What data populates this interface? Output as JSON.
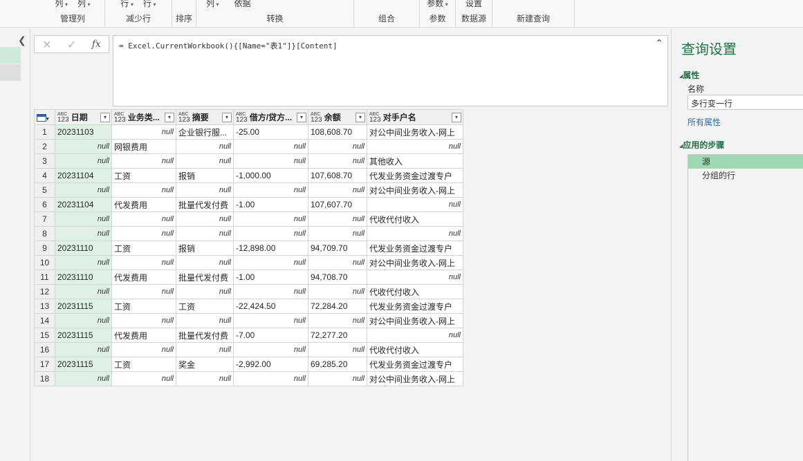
{
  "ribbon": {
    "groups": [
      {
        "label": "管理列",
        "items": [
          "列",
          "列"
        ]
      },
      {
        "label": "减少行",
        "items": [
          "行",
          "行"
        ]
      },
      {
        "label": "排序",
        "items": []
      },
      {
        "label": "转换",
        "items": [
          "列",
          "依据"
        ]
      },
      {
        "label": "组合",
        "items": []
      },
      {
        "label": "参数",
        "items": [
          "参数"
        ]
      },
      {
        "label": "数据源",
        "items": [
          "设置"
        ]
      },
      {
        "label": "新建查询",
        "items": []
      }
    ]
  },
  "formula": {
    "text": "= Excel.CurrentWorkbook(){[Name=\"表1\"]}[Content]",
    "cancel_icon": "✕",
    "commit_icon": "✓",
    "fx_label": "fx"
  },
  "grid": {
    "type_tag_top": "ABC",
    "type_tag_bottom": "123",
    "columns": [
      "日期",
      "业务类...",
      "摘要",
      "借方/贷方...",
      "余额",
      "对手户名"
    ],
    "rows": [
      [
        "1",
        "20231103",
        "null",
        "企业银行服...",
        "-25.00",
        "108,608.70",
        "对公中间业务收入-网上"
      ],
      [
        "2",
        "null",
        "网银费用",
        "null",
        "null",
        "null",
        "null"
      ],
      [
        "3",
        "null",
        "null",
        "null",
        "null",
        "null",
        "其他收入"
      ],
      [
        "4",
        "20231104",
        "工资",
        "报销",
        "-1,000.00",
        "107,608.70",
        "代发业务资金过渡专户"
      ],
      [
        "5",
        "null",
        "null",
        "null",
        "null",
        "null",
        "对公中间业务收入-网上"
      ],
      [
        "6",
        "20231104",
        "代发费用",
        "批量代发付费",
        "-1.00",
        "107,607.70",
        "null"
      ],
      [
        "7",
        "null",
        "null",
        "null",
        "null",
        "null",
        "代收代付收入"
      ],
      [
        "8",
        "null",
        "null",
        "null",
        "null",
        "null",
        "null"
      ],
      [
        "9",
        "20231110",
        "工资",
        "报销",
        "-12,898.00",
        "94,709.70",
        "代发业务资金过渡专户"
      ],
      [
        "10",
        "null",
        "null",
        "null",
        "null",
        "null",
        "对公中间业务收入-网上"
      ],
      [
        "11",
        "20231110",
        "代发费用",
        "批量代发付费",
        "-1.00",
        "94,708.70",
        "null"
      ],
      [
        "12",
        "null",
        "null",
        "null",
        "null",
        "null",
        "代收代付收入"
      ],
      [
        "13",
        "20231115",
        "工资",
        "工资",
        "-22,424.50",
        "72,284.20",
        "代发业务资金过渡专户"
      ],
      [
        "14",
        "null",
        "null",
        "null",
        "null",
        "null",
        "对公中间业务收入-网上"
      ],
      [
        "15",
        "20231115",
        "代发费用",
        "批量代发付费",
        "-7.00",
        "72,277.20",
        "null"
      ],
      [
        "16",
        "null",
        "null",
        "null",
        "null",
        "null",
        "代收代付收入"
      ],
      [
        "17",
        "20231115",
        "工资",
        "奖金",
        "-2,992.00",
        "69,285.20",
        "代发业务资金过渡专户"
      ],
      [
        "18",
        "null",
        "null",
        "null",
        "null",
        "null",
        "对公中间业务收入-网上"
      ]
    ]
  },
  "settings": {
    "title": "查询设置",
    "properties_header": "属性",
    "name_label": "名称",
    "name_value": "多行变一行",
    "all_properties_link": "所有属性",
    "steps_header": "应用的步骤",
    "steps": [
      "源",
      "分组的行"
    ],
    "selected_step": 0
  },
  "colors": {
    "accent": "#217346",
    "selected_step": "#9ed8b3",
    "first_col": "#dff1e6"
  }
}
